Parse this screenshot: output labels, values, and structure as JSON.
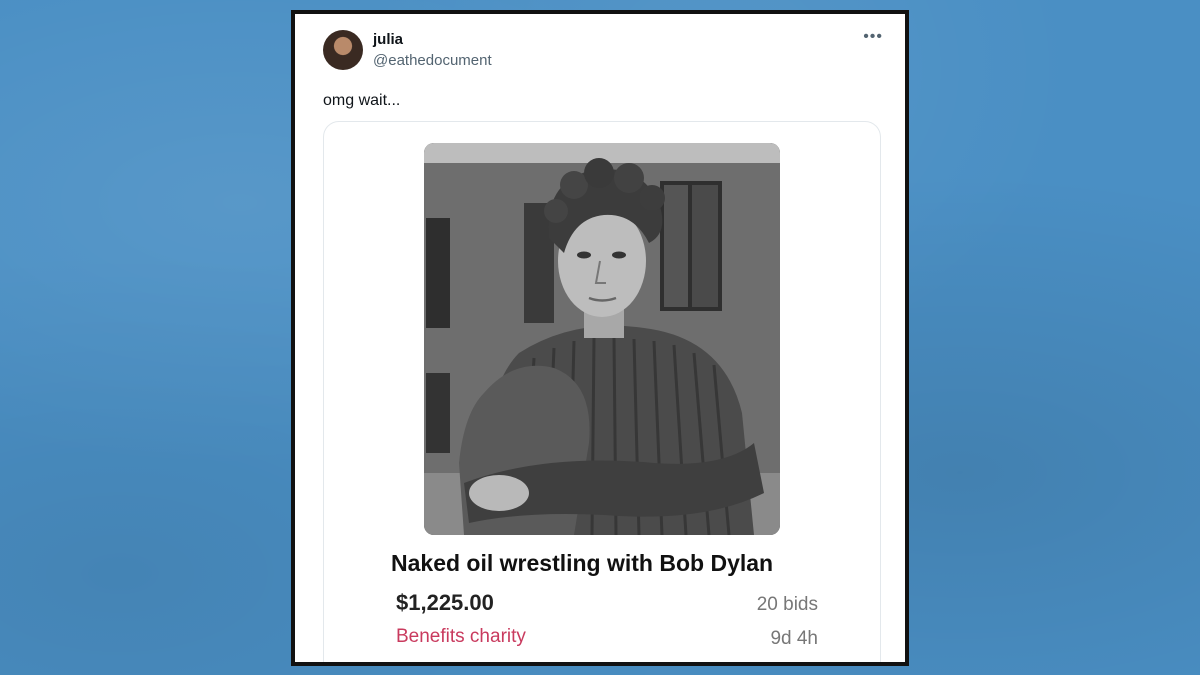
{
  "tweet": {
    "user_name": "julia",
    "user_handle": "@eathedocument",
    "more_label": "•••",
    "text": "omg wait..."
  },
  "listing": {
    "title": "Naked oil wrestling  with Bob Dylan",
    "price": "$1,225.00",
    "bids": "20 bids",
    "charity": "Benefits charity",
    "time_left": "9d 4h"
  },
  "colors": {
    "background": "#4a8fc4",
    "charity": "#c93a5e",
    "handle": "#536471"
  }
}
